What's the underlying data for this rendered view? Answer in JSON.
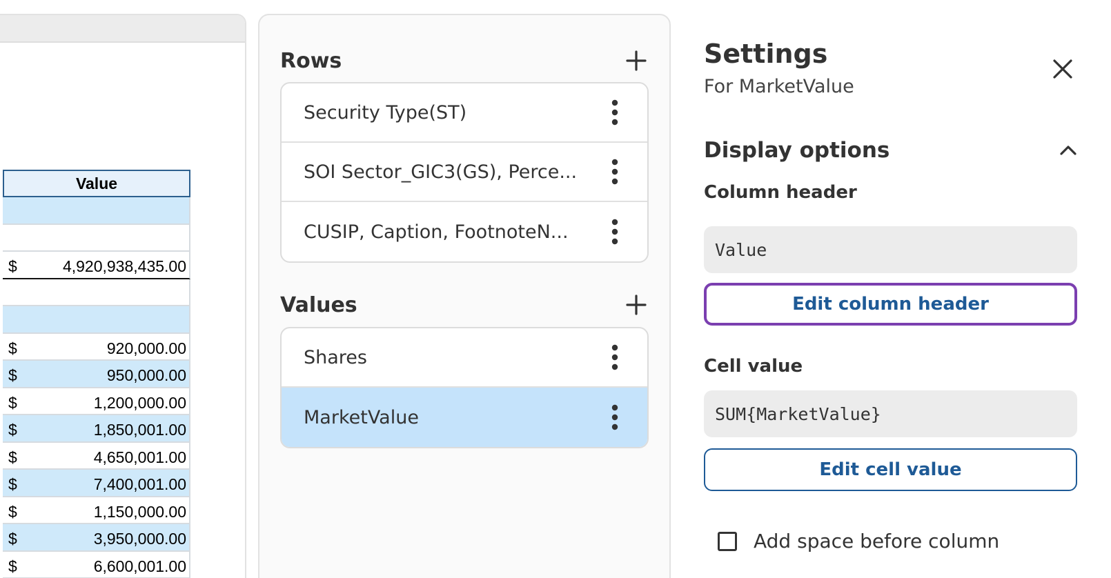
{
  "preview": {
    "column_header": "Value",
    "rows": [
      {
        "currency": "",
        "amount": "",
        "style": "blue"
      },
      {
        "currency": "",
        "amount": "",
        "style": "white"
      },
      {
        "currency": "$",
        "amount": "4,920,938,435.00",
        "style": "total"
      },
      {
        "currency": "",
        "amount": "",
        "style": "white"
      },
      {
        "currency": "",
        "amount": "",
        "style": "blue"
      },
      {
        "currency": "$",
        "amount": "920,000.00",
        "style": "white"
      },
      {
        "currency": "$",
        "amount": "950,000.00",
        "style": "blue"
      },
      {
        "currency": "$",
        "amount": "1,200,000.00",
        "style": "white"
      },
      {
        "currency": "$",
        "amount": "1,850,001.00",
        "style": "blue"
      },
      {
        "currency": "$",
        "amount": "4,650,001.00",
        "style": "white"
      },
      {
        "currency": "$",
        "amount": "7,400,001.00",
        "style": "blue"
      },
      {
        "currency": "$",
        "amount": "1,150,000.00",
        "style": "white"
      },
      {
        "currency": "$",
        "amount": "3,950,000.00",
        "style": "blue"
      },
      {
        "currency": "$",
        "amount": "6,600,001.00",
        "style": "white"
      }
    ]
  },
  "fields": {
    "rows_title": "Rows",
    "rows": [
      {
        "label": "Security Type(ST)"
      },
      {
        "label": "SOI Sector_GIC3(GS), Perce..."
      },
      {
        "label": "CUSIP, Caption, FootnoteN..."
      }
    ],
    "values_title": "Values",
    "values": [
      {
        "label": "Shares",
        "selected": false
      },
      {
        "label": "MarketValue",
        "selected": true
      }
    ]
  },
  "settings": {
    "title": "Settings",
    "subtitle": "For MarketValue",
    "display_options_title": "Display options",
    "column_header_label": "Column header",
    "column_header_value": "Value",
    "edit_column_header_label": "Edit column header",
    "cell_value_label": "Cell value",
    "cell_value_value": "SUM{MarketValue}",
    "edit_cell_value_label": "Edit cell value",
    "add_space_label": "Add space before column",
    "add_space_checked": false
  },
  "icons": {
    "add": "plus-icon",
    "more": "kebab-icon",
    "close": "close-icon",
    "collapse": "chevron-up-icon"
  },
  "colors": {
    "accent": "#1e5a96",
    "focus_ring": "#7b3fb0",
    "selected_row": "#c5e3fb",
    "sheet_blue": "#cfe9fa"
  }
}
